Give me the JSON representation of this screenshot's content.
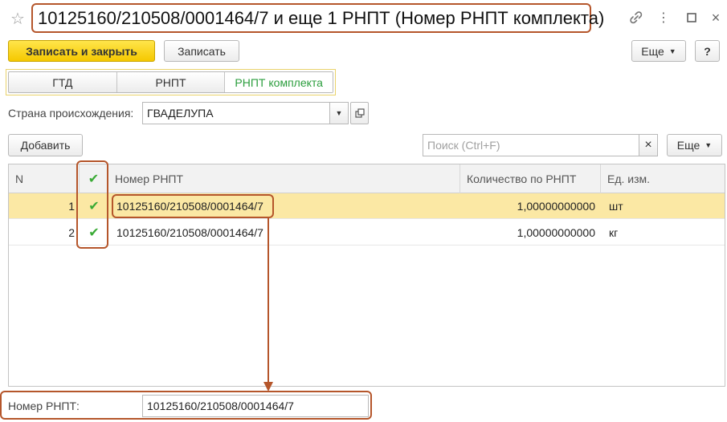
{
  "window": {
    "title": "10125160/210508/0001464/7 и еще 1 РНПТ (Номер РНПТ комплекта)",
    "icons": [
      "star-icon",
      "link-icon",
      "more-vertical-icon",
      "maximize-icon",
      "close-icon"
    ]
  },
  "toolbar": {
    "save_close_label": "Записать и закрыть",
    "save_label": "Записать",
    "more_label": "Еще",
    "help_label": "?"
  },
  "tabs": [
    {
      "label": "ГТД",
      "active": false
    },
    {
      "label": "РНПТ",
      "active": false
    },
    {
      "label": "РНПТ комплекта",
      "active": true
    }
  ],
  "country": {
    "label": "Страна происхождения:",
    "value": "ГВАДЕЛУПА"
  },
  "table_toolbar": {
    "add_label": "Добавить",
    "search_placeholder": "Поиск (Ctrl+F)",
    "clear_label": "×",
    "more_label": "Еще"
  },
  "table": {
    "columns": [
      "N",
      "✔",
      "Номер РНПТ",
      "Количество по РНПТ",
      "Ед. изм."
    ],
    "rows": [
      {
        "n": "1",
        "checked": true,
        "rnpt": "10125160/210508/0001464/7",
        "qty": "1,00000000000",
        "unit": "шт",
        "selected": true
      },
      {
        "n": "2",
        "checked": true,
        "rnpt": "10125160/210508/0001464/7",
        "qty": "1,00000000000",
        "unit": "кг",
        "selected": false
      }
    ]
  },
  "footer": {
    "label": "Номер РНПТ:",
    "value": "10125160/210508/0001464/7"
  },
  "colors": {
    "accent_yellow": "#f5c800",
    "annotation": "#b5562b",
    "check_green": "#3aaa35",
    "active_tab": "#2a9d3c",
    "selected_row": "#fbe8a4"
  }
}
